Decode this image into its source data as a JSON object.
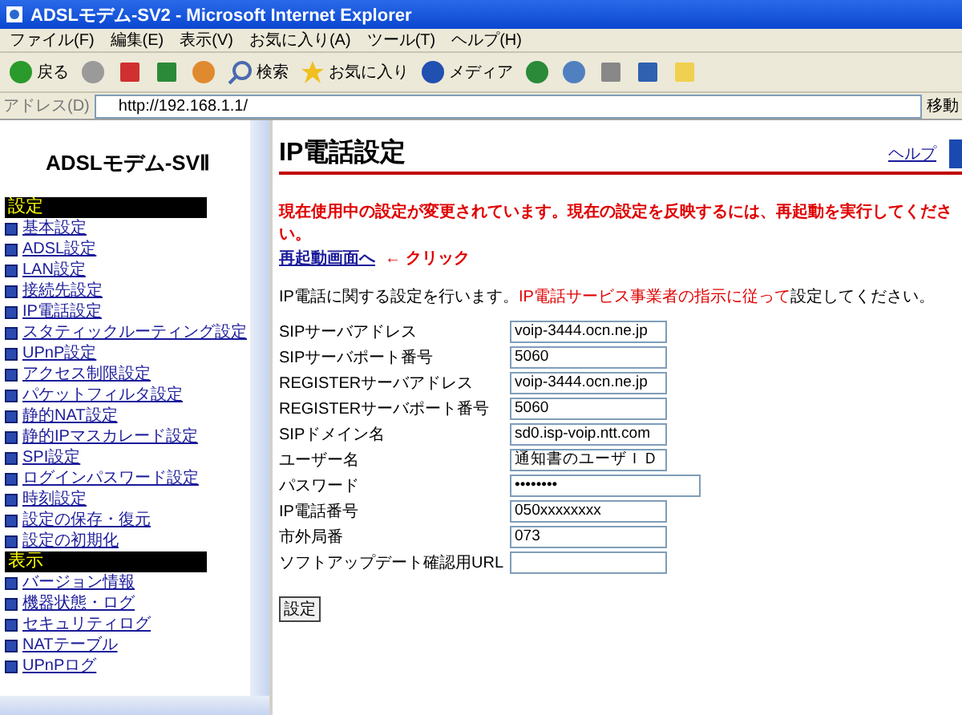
{
  "window": {
    "title": "ADSLモデム-SV2 - Microsoft Internet Explorer"
  },
  "menu": [
    "ファイル(F)",
    "編集(E)",
    "表示(V)",
    "お気に入り(A)",
    "ツール(T)",
    "ヘルプ(H)"
  ],
  "toolbar": [
    {
      "kind": "back",
      "label": "戻る"
    },
    {
      "kind": "forward"
    },
    {
      "kind": "stop"
    },
    {
      "kind": "refresh"
    },
    {
      "kind": "home"
    },
    {
      "kind": "search",
      "label": "検索"
    },
    {
      "kind": "favorites",
      "label": "お気に入り"
    },
    {
      "kind": "media",
      "label": "メディア"
    },
    {
      "kind": "history"
    },
    {
      "kind": "mail"
    },
    {
      "kind": "print"
    },
    {
      "kind": "edit"
    },
    {
      "kind": "note"
    }
  ],
  "address": {
    "label": "アドレス(D)",
    "url": "http://192.168.1.1/",
    "go": "移動"
  },
  "sidebar": {
    "title": "ADSLモデム-SVⅡ",
    "sections": [
      {
        "header": "設定",
        "items": [
          "基本設定",
          "ADSL設定",
          "LAN設定",
          "接続先設定",
          "IP電話設定",
          "スタティックルーティング設定",
          "UPnP設定",
          "アクセス制限設定",
          "パケットフィルタ設定",
          "静的NAT設定",
          "静的IPマスカレード設定",
          "SPI設定",
          "ログインパスワード設定",
          "時刻設定",
          "設定の保存・復元",
          "設定の初期化"
        ]
      },
      {
        "header": "表示",
        "items": [
          "バージョン情報",
          "機器状態・ログ",
          "セキュリティログ",
          "NATテーブル",
          "UPnPログ"
        ]
      }
    ]
  },
  "main": {
    "heading": "IP電話設定",
    "help": "ヘルプ",
    "warning": "現在使用中の設定が変更されています。現在の設定を反映するには、再起動を実行してください。",
    "restart_link": "再起動画面へ",
    "click_note": "← クリック",
    "description": [
      {
        "text": "IP電話に関する設定を行います。",
        "emphasis": false
      },
      {
        "text": "IP電話サービス事業者の指示に従って",
        "emphasis": true
      },
      {
        "text": "設定してください。",
        "emphasis": false
      }
    ],
    "fields": [
      {
        "label": "SIPサーバアドレス",
        "value": "voip-3444.ocn.ne.jp",
        "kind": "text"
      },
      {
        "label": "SIPサーバポート番号",
        "value": "5060",
        "kind": "text"
      },
      {
        "label": "REGISTERサーバアドレス",
        "value": "voip-3444.ocn.ne.jp",
        "kind": "text"
      },
      {
        "label": "REGISTERサーバポート番号",
        "value": "5060",
        "kind": "text"
      },
      {
        "label": "SIPドメイン名",
        "value": "sd0.isp-voip.ntt.com",
        "kind": "text"
      },
      {
        "label": "ユーザー名",
        "value": "通知書のユーザＩＤ",
        "kind": "text"
      },
      {
        "label": "パスワード",
        "value": "••••••••",
        "kind": "password"
      },
      {
        "label": "IP電話番号",
        "value": "050xxxxxxxx",
        "kind": "text"
      },
      {
        "label": "市外局番",
        "value": "073",
        "kind": "text"
      },
      {
        "label": "ソフトアップデート確認用URL",
        "kind": "text"
      }
    ],
    "submit": "設定"
  }
}
